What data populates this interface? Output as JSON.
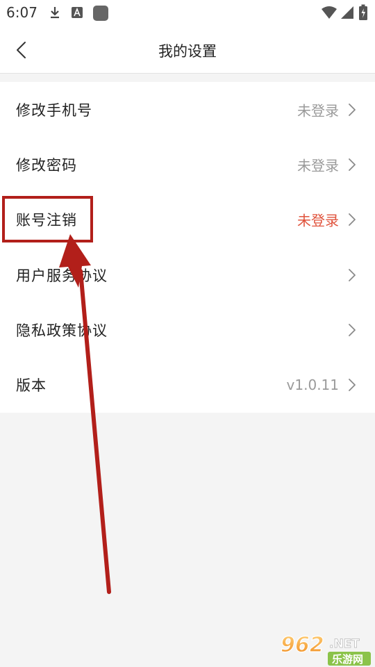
{
  "status_bar": {
    "time": "6:07",
    "icons": [
      "download-icon",
      "text-a-icon",
      "app-square-icon",
      "wifi-icon",
      "signal-icon",
      "battery-icon"
    ]
  },
  "header": {
    "title": "我的设置",
    "back_icon": "chevron-left-icon"
  },
  "settings": {
    "items": [
      {
        "label": "修改手机号",
        "value": "未登录"
      },
      {
        "label": "修改密码",
        "value": "未登录"
      },
      {
        "label": "账号注销",
        "value": "未登录"
      },
      {
        "label": "用户服务协议",
        "value": ""
      },
      {
        "label": "隐私政策协议",
        "value": ""
      },
      {
        "label": "版本",
        "value": "v1.0.11"
      }
    ]
  },
  "annotation": {
    "color": "#b21f1a",
    "highlighted_item": "账号注销"
  },
  "colors": {
    "accent_red": "#e0533c",
    "value_gray": "#9a9a9a",
    "page_bg": "#f4f4f4"
  },
  "watermark": {
    "brand_number": "962",
    "brand_suffix": ".NET",
    "brand_sub": "乐游网"
  }
}
